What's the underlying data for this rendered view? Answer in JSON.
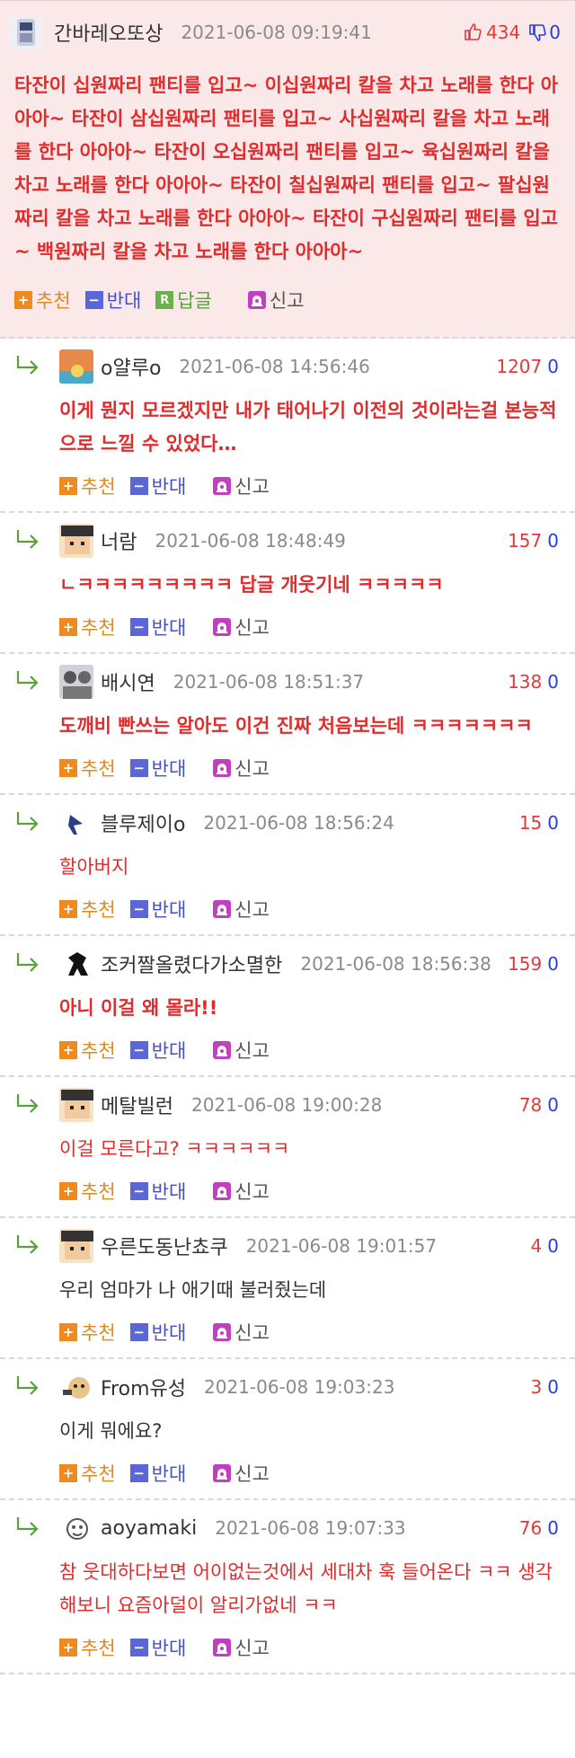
{
  "best": {
    "username": "간바레오또상",
    "date": "2021-06-08 09:19:41",
    "up": "434",
    "down": "0",
    "body": "타잔이 십원짜리 팬티를 입고~ 이십원짜리 칼을 차고 노래를 한다 아아아~ 타잔이 삼십원짜리 팬티를 입고~ 사십원짜리 칼을 차고 노래를 한다 아아아~ 타잔이 오십원짜리 팬티를 입고~ 육십원짜리 칼을 차고 노래를 한다 아아아~ 타잔이 칠십원짜리 팬티를 입고~ 팔십원짜리 칼을 차고 노래를 한다 아아아~ 타잔이 구십원짜리 팬티를 입고~ 백원짜리 칼을 차고 노래를 한다 아아아~",
    "recommend": "추천",
    "oppose": "반대",
    "reply": "답글",
    "report": "신고"
  },
  "actions": {
    "recommend": "추천",
    "oppose": "반대",
    "report": "신고"
  },
  "replies": [
    {
      "username": "o얄루o",
      "date": "2021-06-08 14:56:46",
      "up": "1207",
      "down": "0",
      "body": "이게 뭔지 모르겠지만 내가 태어나기 이전의 것이라는걸 본능적으로 느낄 수 있었다…",
      "style": "red"
    },
    {
      "username": "너람",
      "date": "2021-06-08 18:48:49",
      "up": "157",
      "down": "0",
      "body": "ㄴㅋㅋㅋㅋㅋㅋㅋㅋㅋ 답글 개웃기네 ㅋㅋㅋㅋㅋ",
      "style": "red"
    },
    {
      "username": "배시연",
      "date": "2021-06-08 18:51:37",
      "up": "138",
      "down": "0",
      "body": "도깨비 빤쓰는 알아도 이건 진짜 처음보는데 ㅋㅋㅋㅋㅋㅋㅋ",
      "style": "red"
    },
    {
      "username": "블루제이o",
      "date": "2021-06-08 18:56:24",
      "up": "15",
      "down": "0",
      "body": "할아버지",
      "style": "redn"
    },
    {
      "username": "조커짤올렸다가소멸한",
      "date": "2021-06-08 18:56:38",
      "up": "159",
      "down": "0",
      "body": "아니 이걸 왜 몰라!!",
      "style": "red"
    },
    {
      "username": "메탈빌런",
      "date": "2021-06-08 19:00:28",
      "up": "78",
      "down": "0",
      "body": "이걸 모른다고? ㅋㅋㅋㅋㅋㅋ",
      "style": "redn"
    },
    {
      "username": "우른도동난쵸쿠",
      "date": "2021-06-08 19:01:57",
      "up": "4",
      "down": "0",
      "body": "우리 엄마가 나 애기때 불러줬는데",
      "style": "black"
    },
    {
      "username": "From유성",
      "date": "2021-06-08 19:03:23",
      "up": "3",
      "down": "0",
      "body": "이게 뭐에요?",
      "style": "black"
    },
    {
      "username": "aoyamaki",
      "date": "2021-06-08 19:07:33",
      "up": "76",
      "down": "0",
      "body": "참 웃대하다보면 어이없는것에서 세대차 훅 들어온다 ㅋㅋ 생각해보니 요즘아덜이 알리가없네 ㅋㅋ",
      "style": "redn"
    }
  ],
  "colors": {
    "best_bg": "#fbe9ea",
    "red_text": "#e02c2c",
    "blue_down": "#2a3ed6",
    "recommend": "#e08a1e",
    "oppose": "#4450c8",
    "reply_arrow": "#5aa03c"
  }
}
